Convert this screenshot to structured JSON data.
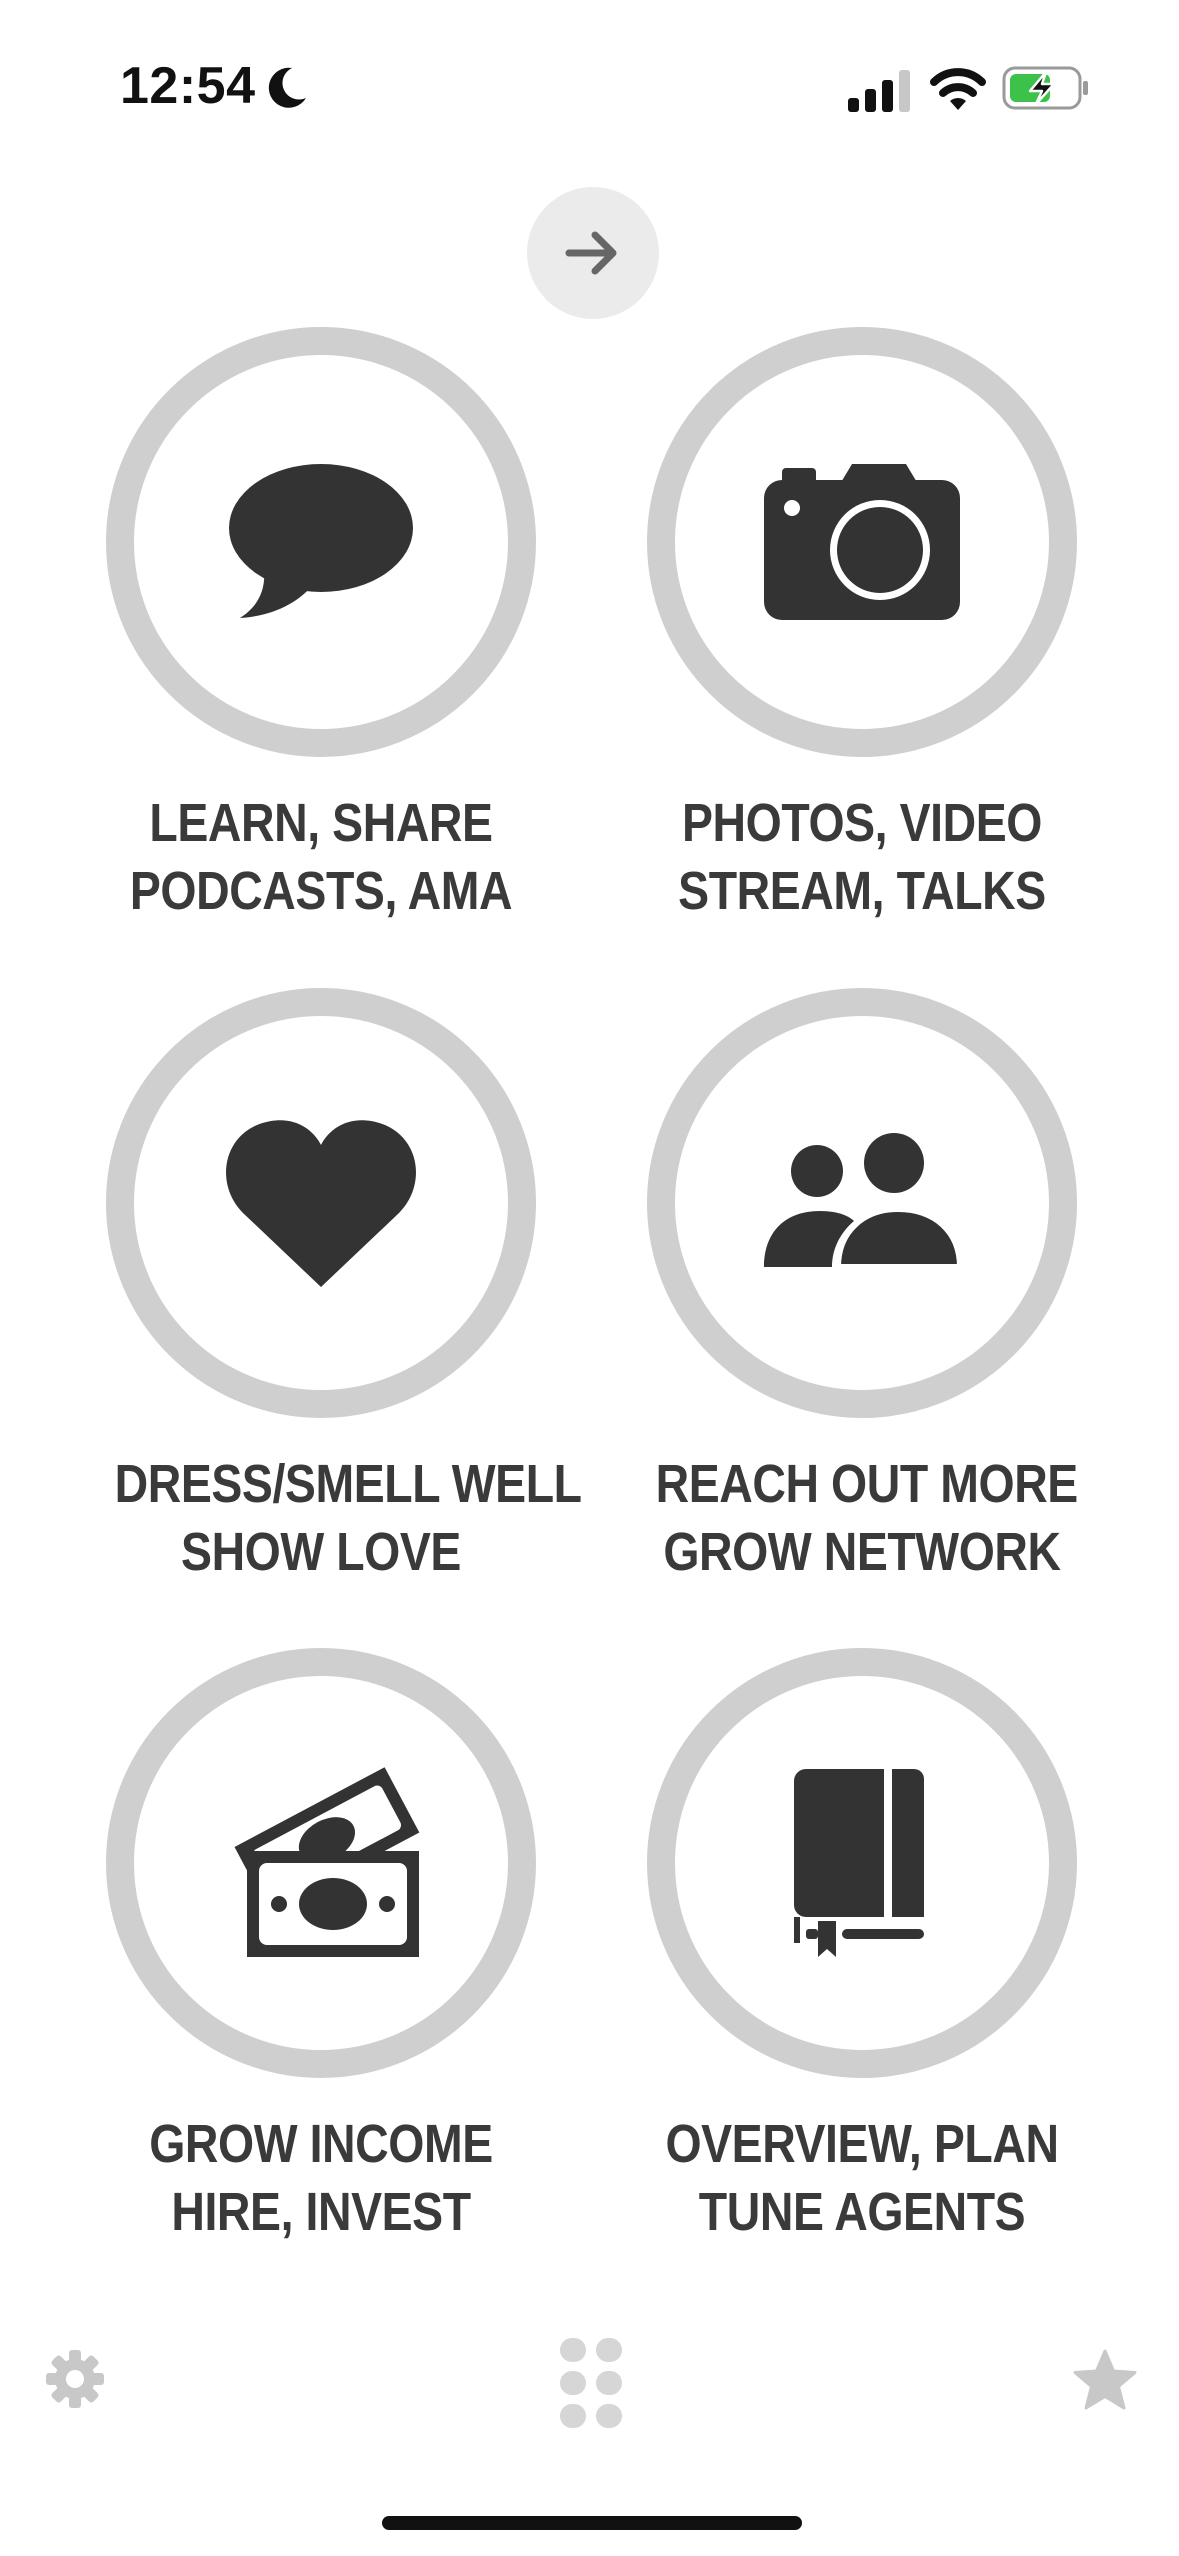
{
  "status_bar": {
    "time": "12:54",
    "icons": [
      "moon-icon",
      "cellular-signal-icon",
      "wifi-icon",
      "battery-charging-icon"
    ],
    "battery_color": "#3cc14a"
  },
  "next_button": {
    "icon": "arrow-right-icon"
  },
  "tiles": [
    {
      "icon": "speech-bubble-icon",
      "line1": "LEARN, SHARE",
      "line2": "PODCASTS, AMA"
    },
    {
      "icon": "camera-icon",
      "line1": "PHOTOS, VIDEO",
      "line2": "STREAM, TALKS"
    },
    {
      "icon": "heart-icon",
      "line1": "DRESS/SMELL WELL",
      "line2": "SHOW LOVE"
    },
    {
      "icon": "people-icon",
      "line1": "REACH OUT MORE",
      "line2": "GROW NETWORK"
    },
    {
      "icon": "money-icon",
      "line1": "GROW INCOME",
      "line2": "HIRE, INVEST"
    },
    {
      "icon": "book-icon",
      "line1": "OVERVIEW, PLAN",
      "line2": "TUNE AGENTS"
    }
  ],
  "bottom_bar": {
    "icons": [
      "settings-gear-icon",
      "grid-dots-icon",
      "star-icon"
    ]
  },
  "colors": {
    "ring": "#cfcfcf",
    "icon": "#333333",
    "label": "#3a3a3a",
    "muted": "#c8c8c8"
  }
}
